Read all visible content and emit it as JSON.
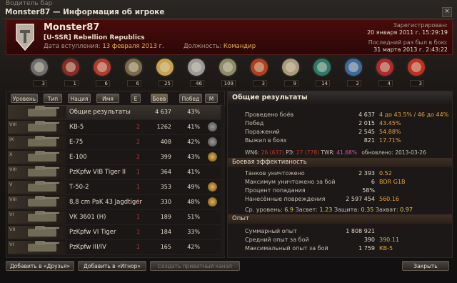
{
  "window": {
    "background_title": "Водитель бар",
    "title": "Monster87 — Информация об игроке",
    "close_label": "×"
  },
  "player": {
    "name": "Monster87",
    "clan": "[U-SSR] Rebellion Republics",
    "join_label": "Дата вступления:",
    "join_date": "13 февраля 2013 г.",
    "role_label": "Должность:",
    "role": "Командир",
    "registered_label": "Зарегистрирован:",
    "registered": "20 января 2011 г. 15:29:19",
    "last_battle_label": "Последний раз был в бою:",
    "last_battle": "31 марта 2013 г. 2:43:22"
  },
  "medals": [
    {
      "icon": "medal-icon",
      "count": "3"
    },
    {
      "icon": "medal-icon",
      "count": "1"
    },
    {
      "icon": "medal-icon",
      "count": "6"
    },
    {
      "icon": "medal-icon",
      "count": "6"
    },
    {
      "icon": "medal-icon",
      "count": "25"
    },
    {
      "icon": "medal-icon",
      "count": "46"
    },
    {
      "icon": "medal-icon",
      "count": "109"
    },
    {
      "icon": "medal-icon",
      "count": "3"
    },
    {
      "icon": "medal-icon",
      "count": "9"
    },
    {
      "icon": "medal-icon",
      "count": "14"
    },
    {
      "icon": "medal-icon",
      "count": "2"
    },
    {
      "icon": "medal-icon",
      "count": "4"
    },
    {
      "icon": "medal-icon",
      "count": "3"
    }
  ],
  "filters": [
    "Уровень",
    "Тип",
    "Нация",
    "Имя",
    "Е",
    "Боев",
    "Побед",
    "М"
  ],
  "vehicles": [
    {
      "tier": "",
      "name": "Общие результаты",
      "red": "",
      "battles": "4 637",
      "wins": "43%",
      "mark": ""
    },
    {
      "tier": "VIII",
      "name": "КВ-5",
      "red": "2",
      "battles": "1262",
      "wins": "41%",
      "mark": "silver"
    },
    {
      "tier": "IX",
      "name": "E-75",
      "red": "2",
      "battles": "408",
      "wins": "42%",
      "mark": "silver"
    },
    {
      "tier": "X",
      "name": "E-100",
      "red": "2",
      "battles": "399",
      "wins": "43%",
      "mark": "gold"
    },
    {
      "tier": "VIII",
      "name": "PzKpfw VIB Tiger II",
      "red": "1",
      "battles": "364",
      "wins": "41%",
      "mark": ""
    },
    {
      "tier": "V",
      "name": "Т-50-2",
      "red": "1",
      "battles": "353",
      "wins": "49%",
      "mark": "gold"
    },
    {
      "tier": "VIII",
      "name": "8,8 cm PaK 43 Jagdtiger",
      "red": "1",
      "battles": "330",
      "wins": "48%",
      "mark": "gold"
    },
    {
      "tier": "VI",
      "name": "VK 3601 (H)",
      "red": "1",
      "battles": "189",
      "wins": "51%",
      "mark": ""
    },
    {
      "tier": "VII",
      "name": "PzKpfw VI Tiger",
      "red": "1",
      "battles": "184",
      "wins": "33%",
      "mark": ""
    },
    {
      "tier": "VI",
      "name": "PzKpfw III/IV",
      "red": "1",
      "battles": "165",
      "wins": "42%",
      "mark": ""
    }
  ],
  "stats": {
    "title": "Общие результаты",
    "general": [
      {
        "label": "Проведено боёв",
        "value": "4 637",
        "extra": "4 до 43.5% / 46 до 44%"
      },
      {
        "label": "Побед",
        "value": "2 015",
        "extra": "43.45%"
      },
      {
        "label": "Поражений",
        "value": "2 545",
        "extra": "54.88%"
      },
      {
        "label": "Выжил в боях",
        "value": "821",
        "extra": "17.71%"
      }
    ],
    "ratings": {
      "wn6_label": "WN6:",
      "wn6_a": "26",
      "wn6_b": "(637)",
      "re_label": "РЭ:",
      "re_a": "27",
      "re_b": "(778)",
      "twr_label": "TWR:",
      "twr": "41.68%",
      "updated": "обновлено: 2013-03-26"
    },
    "efficiency_title": "Боевая эффективность",
    "efficiency": [
      {
        "label": "Танков уничтожено",
        "value": "2 393",
        "extra": "0.52"
      },
      {
        "label": "Максимум уничтожено за бой",
        "value": "6",
        "extra": "BDR G1B"
      },
      {
        "label": "Процент попадания",
        "value": "58%",
        "extra": ""
      },
      {
        "label": "Нанесённые повреждения",
        "value": "2 597 454",
        "extra": "560.16"
      }
    ],
    "averages": {
      "level_label": "Ср. уровень:",
      "level": "6.9",
      "spot_label": "Засвет:",
      "spot": "1.23",
      "def_label": "Защита:",
      "def": "0.35",
      "cap_label": "Захват:",
      "cap": "0.97"
    },
    "exp_title": "Опыт",
    "exp": [
      {
        "label": "Суммарный опыт",
        "value": "1 808 921",
        "extra": ""
      },
      {
        "label": "Средний опыт за бой",
        "value": "390",
        "extra": "390.11"
      },
      {
        "label": "Максимальный опыт за бой",
        "value": "1 759",
        "extra": "КВ-5"
      }
    ]
  },
  "buttons": {
    "add_friends": "Добавить в «Друзья»",
    "add_ignore": "Добавить в «Игнор»",
    "private_channel": "Создать приватный канал",
    "close": "Закрыть"
  }
}
